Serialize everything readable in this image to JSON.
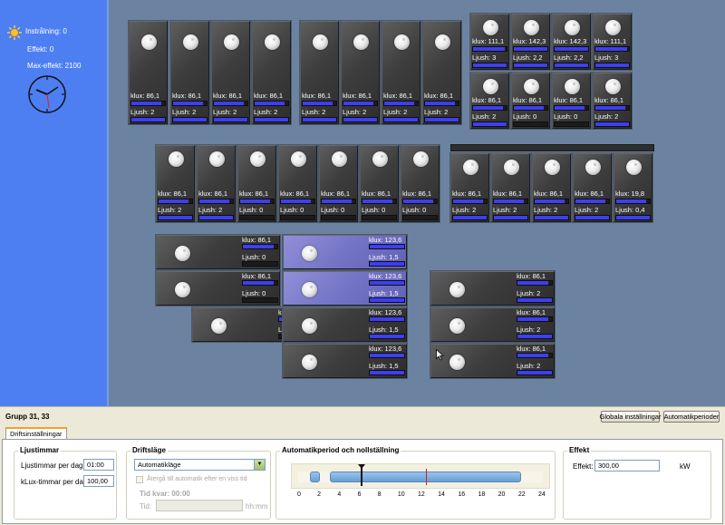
{
  "sidebar": {
    "radiation": "Instrålning: 0",
    "power": "Effekt: 0",
    "max_power": "Max-effekt: 2100"
  },
  "tile_labels": {
    "klux_prefix": "klux:",
    "ljush_prefix": "Ljush:"
  },
  "tiles": [
    {
      "klux": "86,1",
      "ljush": "2",
      "klux_fill": 0.9,
      "ljush_fill": 1.0
    },
    {
      "klux": "86,1",
      "ljush": "2",
      "klux_fill": 0.9,
      "ljush_fill": 1.0
    },
    {
      "klux": "86,1",
      "ljush": "2",
      "klux_fill": 0.9,
      "ljush_fill": 1.0
    },
    {
      "klux": "86,1",
      "ljush": "2",
      "klux_fill": 0.9,
      "ljush_fill": 1.0
    },
    {
      "klux": "86,1",
      "ljush": "2",
      "klux_fill": 0.9,
      "ljush_fill": 1.0
    },
    {
      "klux": "86,1",
      "ljush": "2",
      "klux_fill": 0.9,
      "ljush_fill": 1.0
    },
    {
      "klux": "86,1",
      "ljush": "2",
      "klux_fill": 0.9,
      "ljush_fill": 1.0
    },
    {
      "klux": "86,1",
      "ljush": "2",
      "klux_fill": 0.9,
      "ljush_fill": 1.0
    },
    {
      "klux": "111,1",
      "ljush": "3",
      "klux_fill": 0.95,
      "ljush_fill": 1.0
    },
    {
      "klux": "142,3",
      "ljush": "2,2",
      "klux_fill": 1.0,
      "ljush_fill": 1.0
    },
    {
      "klux": "142,3",
      "ljush": "2,2",
      "klux_fill": 1.0,
      "ljush_fill": 1.0
    },
    {
      "klux": "111,1",
      "ljush": "3",
      "klux_fill": 0.95,
      "ljush_fill": 1.0
    },
    {
      "klux": "86,1",
      "ljush": "2",
      "klux_fill": 0.9,
      "ljush_fill": 1.0
    },
    {
      "klux": "86,1",
      "ljush": "0",
      "klux_fill": 0.9,
      "ljush_fill": 0.0
    },
    {
      "klux": "86,1",
      "ljush": "0",
      "klux_fill": 0.9,
      "ljush_fill": 0.0
    },
    {
      "klux": "86,1",
      "ljush": "2",
      "klux_fill": 0.9,
      "ljush_fill": 1.0
    },
    {
      "klux": "86,1",
      "ljush": "2",
      "klux_fill": 0.9,
      "ljush_fill": 1.0
    },
    {
      "klux": "86,1",
      "ljush": "2",
      "klux_fill": 0.9,
      "ljush_fill": 1.0
    },
    {
      "klux": "86,1",
      "ljush": "0",
      "klux_fill": 0.9,
      "ljush_fill": 0.0
    },
    {
      "klux": "86,1",
      "ljush": "0",
      "klux_fill": 0.9,
      "ljush_fill": 0.0
    },
    {
      "klux": "86,1",
      "ljush": "0",
      "klux_fill": 0.9,
      "ljush_fill": 0.0
    },
    {
      "klux": "86,1",
      "ljush": "0",
      "klux_fill": 0.9,
      "ljush_fill": 0.0
    },
    {
      "klux": "86,1",
      "ljush": "0",
      "klux_fill": 0.9,
      "ljush_fill": 0.0
    },
    {
      "klux": "86,1",
      "ljush": "2",
      "klux_fill": 0.9,
      "ljush_fill": 1.0
    },
    {
      "klux": "86,1",
      "ljush": "2",
      "klux_fill": 0.9,
      "ljush_fill": 1.0
    },
    {
      "klux": "86,1",
      "ljush": "2",
      "klux_fill": 0.9,
      "ljush_fill": 1.0
    },
    {
      "klux": "86,1",
      "ljush": "2",
      "klux_fill": 0.9,
      "ljush_fill": 1.0
    },
    {
      "klux": "19,8",
      "ljush": "0,4",
      "klux_fill": 0.9,
      "ljush_fill": 1.0
    },
    {
      "klux": "86,1",
      "ljush": "0",
      "klux_fill": 0.9,
      "ljush_fill": 0.0
    },
    {
      "klux": "123,6",
      "ljush": "1,5",
      "klux_fill": 1.0,
      "ljush_fill": 1.0,
      "sel": true
    },
    {
      "klux": "86,1",
      "ljush": "0",
      "klux_fill": 0.9,
      "ljush_fill": 0.0
    },
    {
      "klux": "123,6",
      "ljush": "1,5",
      "klux_fill": 1.0,
      "ljush_fill": 1.0,
      "sel": true
    },
    {
      "klux": "86,1",
      "ljush": "2",
      "klux_fill": 0.9,
      "ljush_fill": 1.0
    },
    {
      "klux": "86,1",
      "ljush": "0",
      "klux_fill": 0.9,
      "ljush_fill": 0.0
    },
    {
      "klux": "123,6",
      "ljush": "1,5",
      "klux_fill": 1.0,
      "ljush_fill": 1.0
    },
    {
      "klux": "86,1",
      "ljush": "2",
      "klux_fill": 0.9,
      "ljush_fill": 1.0
    },
    {
      "klux": "123,6",
      "ljush": "1,5",
      "klux_fill": 1.0,
      "ljush_fill": 1.0
    },
    {
      "klux": "86,1",
      "ljush": "2",
      "klux_fill": 0.9,
      "ljush_fill": 1.0
    }
  ],
  "panel": {
    "group_title": "Grupp 31, 33",
    "global_settings": "Globala inställningar",
    "auto_periods": "Automatikperioder",
    "tab": "Driftsinställningar",
    "ljustimmar": {
      "title": "Ljustimmar",
      "per_day_label": "Ljustimmar per dag:",
      "per_day_value": "01:00",
      "klux_label": "kLux-timmar per dag:",
      "klux_value": "100,00"
    },
    "driftlage": {
      "title": "Driftsläge",
      "mode": "Automatikläge",
      "return_label": "Återgå till automatik efter en viss tid",
      "time_left": "Tid kvar: 00:00",
      "time_label": "Tid:",
      "time_unit": "hh:mm"
    },
    "period": {
      "title": "Automatikperiod och nollställning",
      "ticks": [
        "0",
        "2",
        "4",
        "6",
        "8",
        "10",
        "12",
        "14",
        "16",
        "18",
        "20",
        "22",
        "24"
      ],
      "blocks": [
        [
          1,
          2
        ],
        [
          3,
          22
        ]
      ],
      "marker_hour": 6,
      "reset_hour": 12.5
    },
    "effekt": {
      "title": "Effekt",
      "label": "Effekt:",
      "value": "300,00",
      "unit": "kW"
    }
  }
}
